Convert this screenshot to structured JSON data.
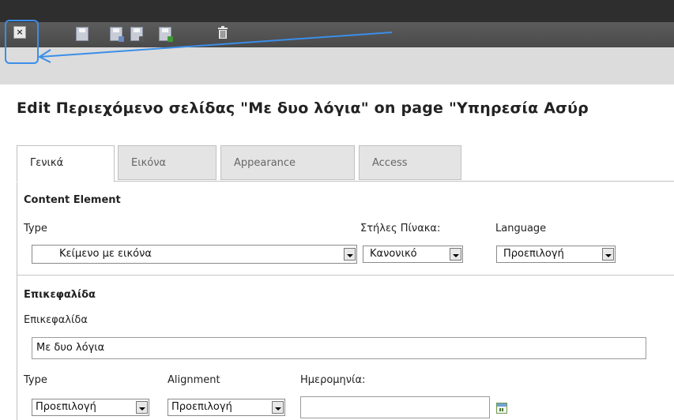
{
  "toolbar": {
    "close": "close-icon",
    "buttons": [
      "save-icon",
      "save-view-icon",
      "save-close-icon",
      "save-new-icon"
    ],
    "delete": "trash-icon"
  },
  "header": {
    "title": "Edit Περιεχόμενο σελίδας \"Με δυο λόγια\" on page \"Υπηρεσία Ασύρ"
  },
  "tabs": [
    "Γενικά",
    "Εικόνα",
    "Appearance",
    "Access"
  ],
  "content_element": {
    "section_title": "Content Element",
    "type_label": "Type",
    "type_value": "Κείμενο με εικόνα",
    "columns_label": "Στήλες Πίνακα:",
    "columns_value": "Κανονικό",
    "language_label": "Language",
    "language_value": "Προεπιλογή"
  },
  "header_section": {
    "section_title": "Επικεφαλίδα",
    "field_label": "Επικεφαλίδα",
    "field_value": "Με δυο λόγια",
    "type_label": "Type",
    "type_value": "Προεπιλογή",
    "alignment_label": "Alignment",
    "alignment_value": "Προεπιλογή",
    "date_label": "Ημερομηνία:",
    "date_value": ""
  },
  "colors": {
    "highlight": "#3b8ee8",
    "toolbar": "#4f4f4f"
  }
}
